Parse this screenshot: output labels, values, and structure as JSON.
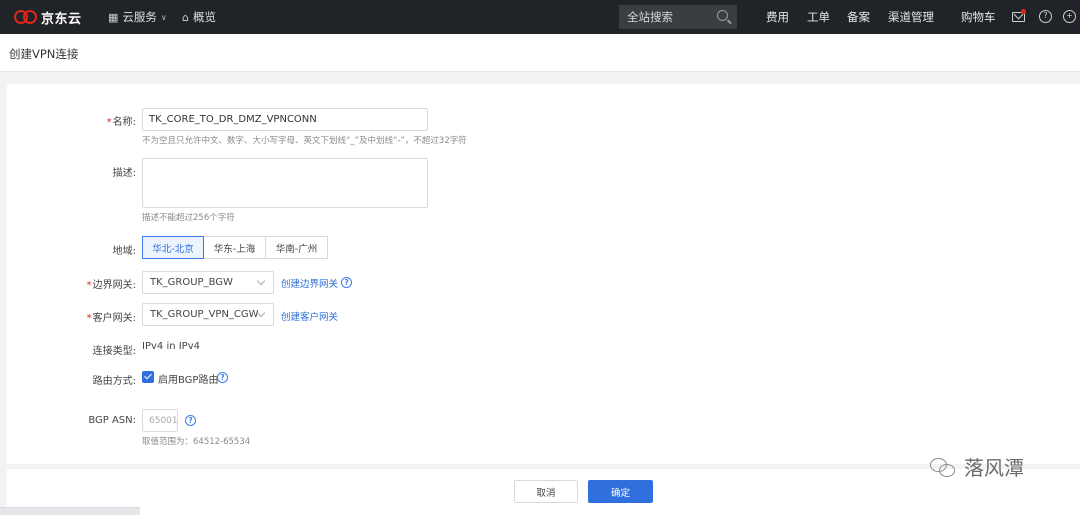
{
  "topbar": {
    "logo_text": "京东云",
    "nav": [
      {
        "label": "云服务",
        "icon": "grid-icon"
      },
      {
        "label": "概览",
        "icon": "home-icon"
      }
    ],
    "search_placeholder": "全站搜索",
    "links": [
      "费用",
      "工单",
      "备案",
      "渠道管理",
      "购物车"
    ]
  },
  "page_title": "创建VPN连接",
  "form": {
    "name": {
      "label": "名称:",
      "value": "TK_CORE_TO_DR_DMZ_VPNCONN",
      "hint": "不为空且只允许中文、数字、大小写字母、英文下划线“_”及中划线“-”，不超过32字符"
    },
    "desc": {
      "label": "描述:",
      "value": "",
      "hint": "描述不能超过256个字符"
    },
    "region": {
      "label": "地域:",
      "options": [
        "华北-北京",
        "华东-上海",
        "华南-广州"
      ],
      "selected": "华北-北京"
    },
    "border_gateway": {
      "label": "边界网关:",
      "value": "TK_GROUP_BGW",
      "link": "创建边界网关"
    },
    "customer_gateway": {
      "label": "客户网关:",
      "value": "TK_GROUP_VPN_CGW",
      "link": "创建客户网关"
    },
    "conn_type": {
      "label": "连接类型:",
      "value": "IPv4 in IPv4"
    },
    "routing": {
      "label": "路由方式:",
      "checkbox_label": "启用BGP路由",
      "checked": true
    },
    "bgp_asn": {
      "label": "BGP ASN:",
      "placeholder": "65001",
      "hint": "取值范围为：64512-65534"
    }
  },
  "buttons": {
    "cancel": "取消",
    "confirm": "确定"
  },
  "watermark": "落风潭",
  "colors": {
    "accent": "#2f6fde",
    "topbar": "#202327",
    "required": "#e1251b"
  }
}
